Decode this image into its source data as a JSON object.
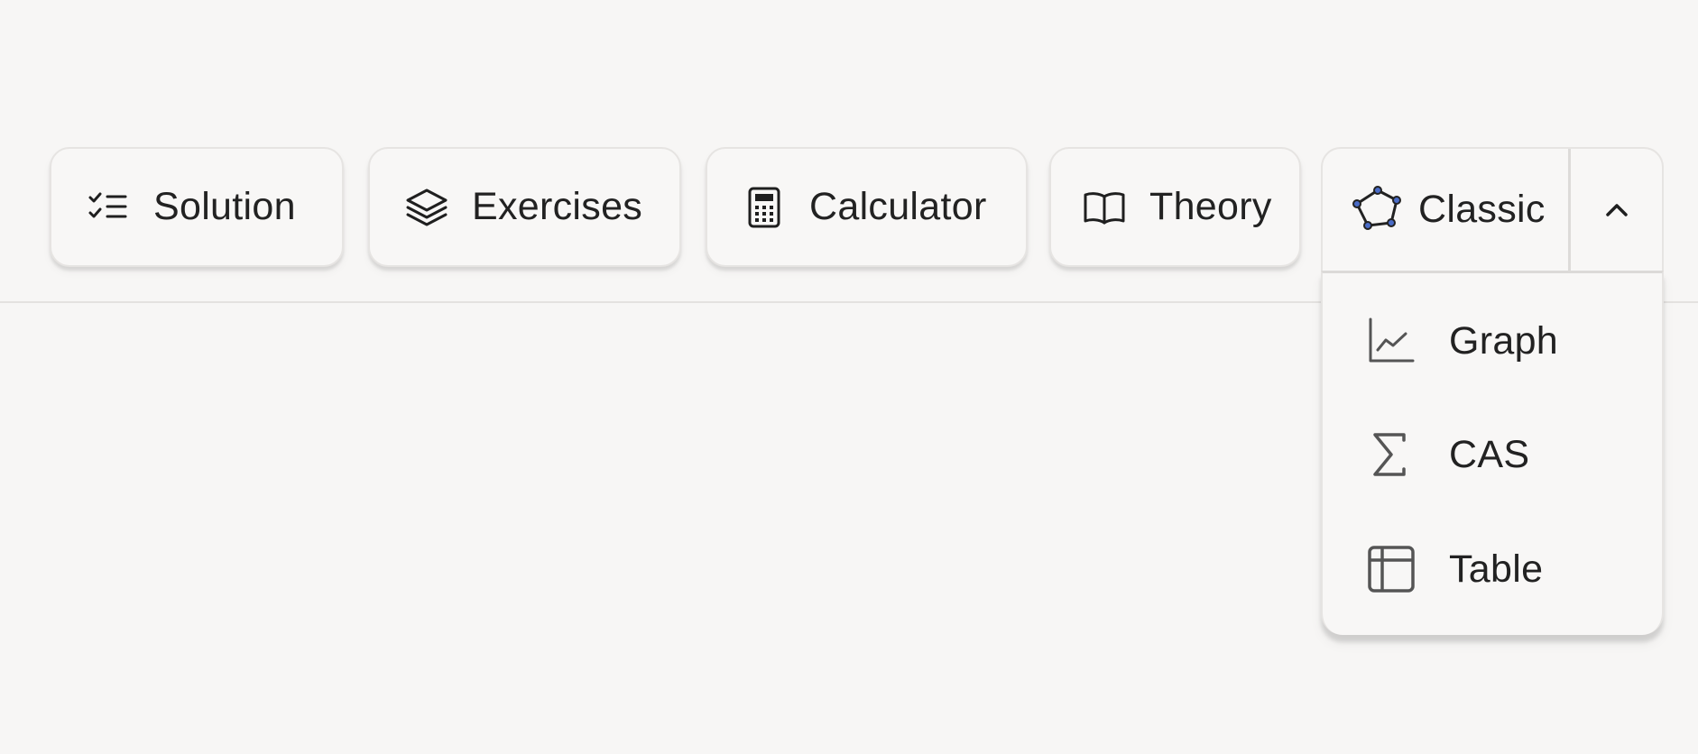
{
  "toolbar": {
    "buttons": [
      {
        "label": "Solution",
        "icon": "checklist-icon"
      },
      {
        "label": "Exercises",
        "icon": "layers-icon"
      },
      {
        "label": "Calculator",
        "icon": "calculator-icon"
      },
      {
        "label": "Theory",
        "icon": "open-book-icon"
      }
    ],
    "app_selector": {
      "label": "Classic",
      "icon": "pentagon-geometry-icon",
      "toggle_icon": "chevron-up-icon",
      "expanded": true
    }
  },
  "dropdown": {
    "items": [
      {
        "label": "Graph",
        "icon": "line-chart-icon"
      },
      {
        "label": "CAS",
        "icon": "sigma-icon"
      },
      {
        "label": "Table",
        "icon": "table-icon"
      }
    ]
  },
  "colors": {
    "background": "#f7f6f5",
    "button_background": "#f8f7f6",
    "border": "#e6e4e2",
    "text": "#222222",
    "icon_dark": "#1f1f1f",
    "icon_gray": "#555555",
    "geometry_vertex": "#4a6cc7"
  }
}
